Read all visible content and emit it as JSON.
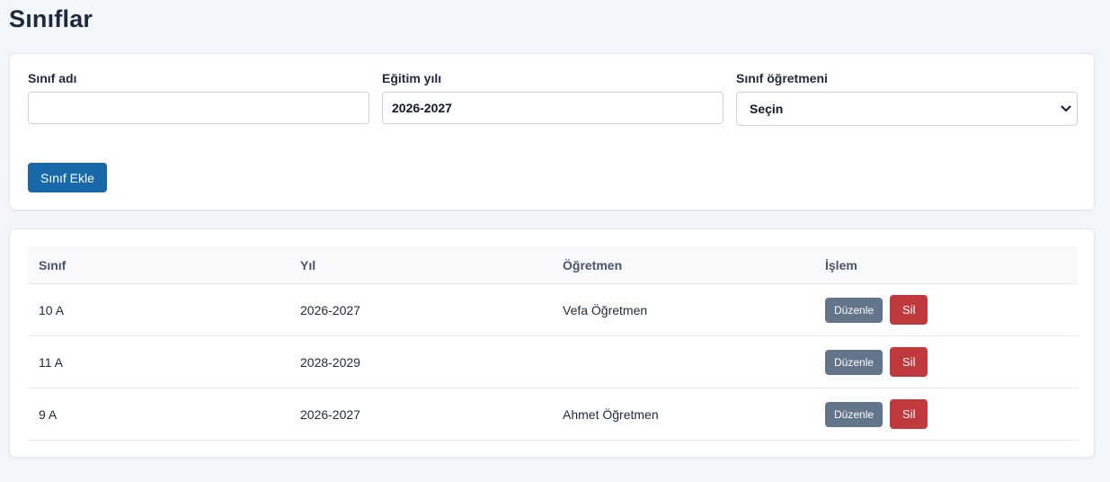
{
  "page": {
    "title": "Sınıflar"
  },
  "form": {
    "class_name": {
      "label": "Sınıf adı",
      "value": ""
    },
    "year": {
      "label": "Eğitim yılı",
      "value": "2026-2027"
    },
    "teacher": {
      "label": "Sınıf öğretmeni",
      "selected": "Seçin"
    },
    "submit_label": "Sınıf Ekle"
  },
  "table": {
    "headers": [
      "Sınıf",
      "Yıl",
      "Öğretmen",
      "İşlem"
    ],
    "rows": [
      {
        "class": "10 A",
        "year": "2026-2027",
        "teacher": "Vefa Öğretmen",
        "edit_label": "Düzenle",
        "delete_label": "Sil"
      },
      {
        "class": "11 A",
        "year": "2028-2029",
        "teacher": "",
        "edit_label": "Düzenle",
        "delete_label": "Sil"
      },
      {
        "class": "9 A",
        "year": "2026-2027",
        "teacher": "Ahmet Öğretmen",
        "edit_label": "Düzenle",
        "delete_label": "Sil"
      }
    ]
  },
  "colors": {
    "primary": "#1769aa",
    "edit": "#64748b",
    "delete": "#c0393d",
    "background": "#f2f5f9"
  }
}
